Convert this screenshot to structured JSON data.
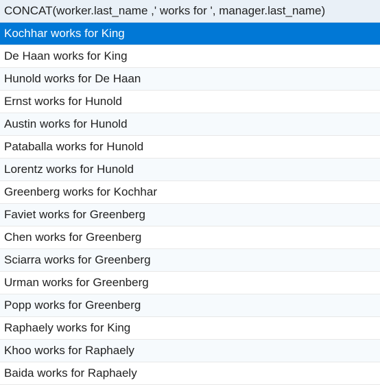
{
  "table": {
    "header": "CONCAT(worker.last_name ,' works for ', manager.last_name)",
    "rows": [
      {
        "text": "Kochhar works for King",
        "selected": true
      },
      {
        "text": "De Haan works for King",
        "selected": false
      },
      {
        "text": "Hunold works for De Haan",
        "selected": false
      },
      {
        "text": "Ernst works for Hunold",
        "selected": false
      },
      {
        "text": "Austin works for Hunold",
        "selected": false
      },
      {
        "text": "Pataballa works for Hunold",
        "selected": false
      },
      {
        "text": "Lorentz works for Hunold",
        "selected": false
      },
      {
        "text": "Greenberg works for Kochhar",
        "selected": false
      },
      {
        "text": "Faviet works for Greenberg",
        "selected": false
      },
      {
        "text": "Chen works for Greenberg",
        "selected": false
      },
      {
        "text": "Sciarra works for Greenberg",
        "selected": false
      },
      {
        "text": "Urman works for Greenberg",
        "selected": false
      },
      {
        "text": "Popp works for Greenberg",
        "selected": false
      },
      {
        "text": "Raphaely works for King",
        "selected": false
      },
      {
        "text": "Khoo works for Raphaely",
        "selected": false
      },
      {
        "text": "Baida works for Raphaely",
        "selected": false
      }
    ]
  }
}
